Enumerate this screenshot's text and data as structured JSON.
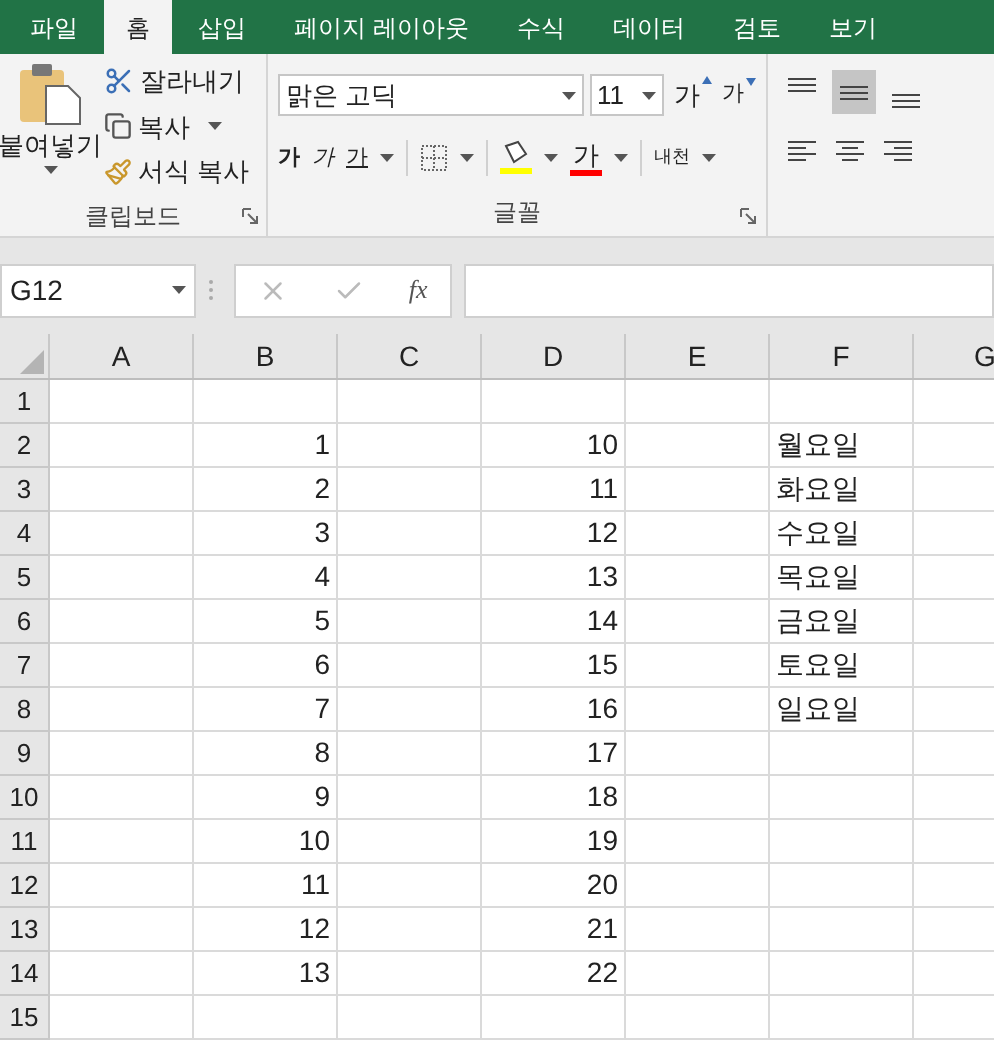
{
  "tabs": [
    {
      "label": "파일",
      "selected": false
    },
    {
      "label": "홈",
      "selected": true
    },
    {
      "label": "삽입",
      "selected": false
    },
    {
      "label": "페이지 레이아웃",
      "selected": false
    },
    {
      "label": "수식",
      "selected": false
    },
    {
      "label": "데이터",
      "selected": false
    },
    {
      "label": "검토",
      "selected": false
    },
    {
      "label": "보기",
      "selected": false
    }
  ],
  "clipboard": {
    "paste": "붙여넣기",
    "cut": "잘라내기",
    "copy": "복사",
    "format_painter": "서식 복사",
    "label": "클립보드"
  },
  "font": {
    "font_name": "맑은 고딕",
    "font_size": "11",
    "grow": "가",
    "shrink": "가",
    "bold": "가",
    "italic": "가",
    "underline": "가",
    "font_color": "가",
    "phonetic": "내천",
    "label": "글꼴"
  },
  "alignment": {
    "vertical": [
      {
        "kind": "top",
        "selected": false
      },
      {
        "kind": "middle",
        "selected": true
      },
      {
        "kind": "bottom",
        "selected": false
      }
    ]
  },
  "formula_bar": {
    "name_box": "G12",
    "function_symbol": "fx"
  },
  "columns": [
    "A",
    "B",
    "C",
    "D",
    "E",
    "F",
    "G"
  ],
  "rows": [
    {
      "number": "1",
      "cells": {}
    },
    {
      "number": "2",
      "cells": {
        "B": "1",
        "D": "10",
        "F": "월요일"
      }
    },
    {
      "number": "3",
      "cells": {
        "B": "2",
        "D": "11",
        "F": "화요일"
      }
    },
    {
      "number": "4",
      "cells": {
        "B": "3",
        "D": "12",
        "F": "수요일"
      }
    },
    {
      "number": "5",
      "cells": {
        "B": "4",
        "D": "13",
        "F": "목요일"
      }
    },
    {
      "number": "6",
      "cells": {
        "B": "5",
        "D": "14",
        "F": "금요일"
      }
    },
    {
      "number": "7",
      "cells": {
        "B": "6",
        "D": "15",
        "F": "토요일"
      }
    },
    {
      "number": "8",
      "cells": {
        "B": "7",
        "D": "16",
        "F": "일요일"
      }
    },
    {
      "number": "9",
      "cells": {
        "B": "8",
        "D": "17"
      }
    },
    {
      "number": "10",
      "cells": {
        "B": "9",
        "D": "18"
      }
    },
    {
      "number": "11",
      "cells": {
        "B": "10",
        "D": "19"
      }
    },
    {
      "number": "12",
      "cells": {
        "B": "11",
        "D": "20"
      }
    },
    {
      "number": "13",
      "cells": {
        "B": "12",
        "D": "21"
      }
    },
    {
      "number": "14",
      "cells": {
        "B": "13",
        "D": "22"
      }
    },
    {
      "number": "15",
      "cells": {}
    }
  ]
}
